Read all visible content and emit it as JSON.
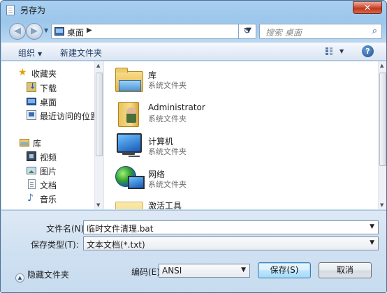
{
  "window": {
    "title": "另存为",
    "close_label": "✕"
  },
  "nav": {
    "address": "桌面",
    "search_placeholder": "搜索 桌面"
  },
  "toolbar": {
    "organize": "组织",
    "new_folder": "新建文件夹",
    "help": "?"
  },
  "sidebar": {
    "favorites_header": "收藏夹",
    "favorites": [
      {
        "label": "下载",
        "icon": "download-icon"
      },
      {
        "label": "桌面",
        "icon": "desktop-icon"
      },
      {
        "label": "最近访问的位置",
        "icon": "recent-places-icon"
      }
    ],
    "libraries_header": "库",
    "libraries": [
      {
        "label": "视频",
        "icon": "video-icon"
      },
      {
        "label": "图片",
        "icon": "picture-icon"
      },
      {
        "label": "文档",
        "icon": "document-icon"
      },
      {
        "label": "音乐",
        "icon": "music-icon"
      }
    ]
  },
  "files": [
    {
      "name": "库",
      "type": "系统文件夹",
      "icon": "library-icon"
    },
    {
      "name": "Administrator",
      "type": "系统文件夹",
      "icon": "user-folder-icon"
    },
    {
      "name": "计算机",
      "type": "系统文件夹",
      "icon": "computer-icon"
    },
    {
      "name": "网络",
      "type": "系统文件夹",
      "icon": "network-icon"
    },
    {
      "name": "激活工具",
      "type": "",
      "icon": "folder-icon"
    }
  ],
  "form": {
    "filename_label": "文件名(N):",
    "filename_value": "临时文件清理.bat",
    "type_label": "保存类型(T):",
    "type_value": "文本文档(*.txt)"
  },
  "footer": {
    "hide_folders": "隐藏文件夹",
    "encoding_label": "编码(E):",
    "encoding_value": "ANSI",
    "save": "保存(S)",
    "cancel": "取消"
  }
}
